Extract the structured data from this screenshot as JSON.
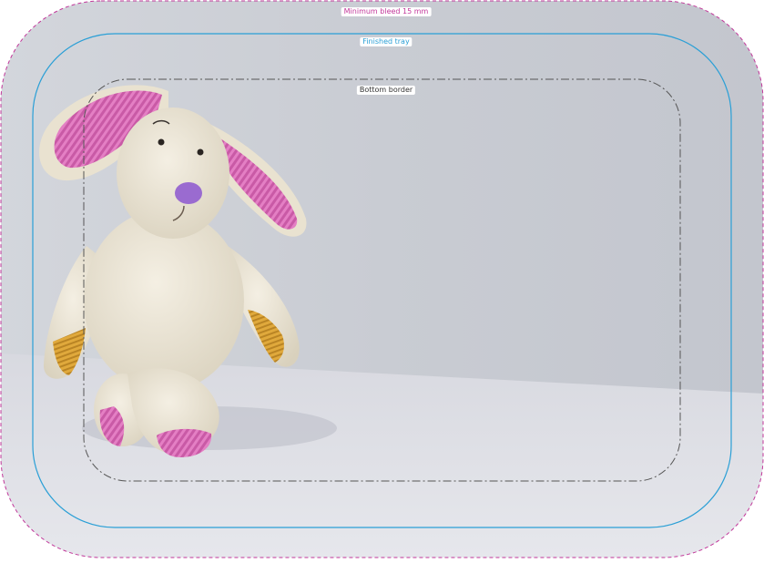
{
  "guides": {
    "bleed_label": "Minimum bleed 15 mm",
    "finished_label": "Finished tray",
    "bottom_label": "Bottom border"
  },
  "colors": {
    "bleed_line": "#c2379a",
    "finished_line": "#2a9fd6",
    "bottom_line": "#555555",
    "wall": "#c9ccd3",
    "floor": "#dfe0e6",
    "plush_body": "#ece6d6",
    "plush_ear_inner": "#e57fc3",
    "plush_nose": "#9a6bd0",
    "plush_paw": "#d9a23a"
  },
  "icons": {
    "subject": "plush-bunny-illustration"
  }
}
